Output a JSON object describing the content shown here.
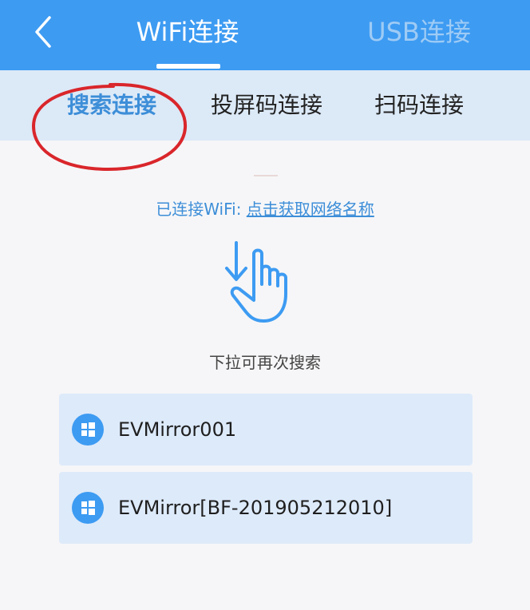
{
  "header": {
    "back_icon": "chevron-left-icon",
    "tabs": [
      {
        "label": "WiFi连接",
        "active": true
      },
      {
        "label": "USB连接",
        "active": false
      }
    ]
  },
  "subtabs": [
    {
      "label": "搜索连接",
      "active": true
    },
    {
      "label": "投屏码连接",
      "active": false
    },
    {
      "label": "扫码连接",
      "active": false
    }
  ],
  "wifi": {
    "prefix": "已连接WiFi: ",
    "link_label": "点击获取网络名称"
  },
  "pull": {
    "icon": "pull-down-hand-icon",
    "hint": "下拉可再次搜索"
  },
  "devices": [
    {
      "name": "EVMirror001",
      "icon": "windows-icon"
    },
    {
      "name": "EVMirror[BF-201905212010]",
      "icon": "windows-icon"
    }
  ],
  "colors": {
    "accent": "#3d9bf2",
    "highlight": "#d9262b"
  }
}
